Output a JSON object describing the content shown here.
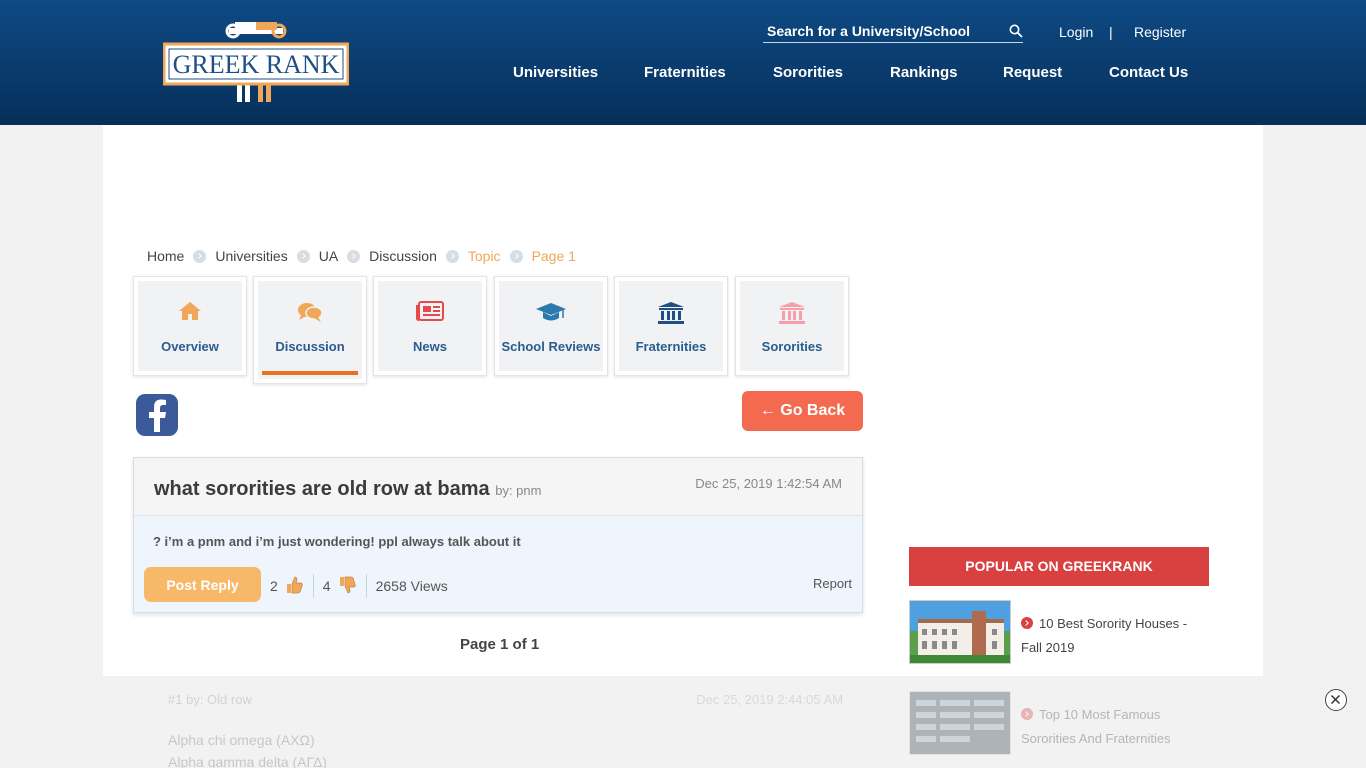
{
  "header": {
    "logo_text": "GREEK RANK",
    "search_placeholder": "Search for a University/School",
    "login": "Login",
    "divider": "|",
    "register": "Register",
    "nav": [
      "Universities",
      "Fraternities",
      "Sororities",
      "Rankings",
      "Request",
      "Contact Us"
    ]
  },
  "breadcrumb": [
    "Home",
    "Universities",
    "UA",
    "Discussion",
    "Topic",
    "Page 1"
  ],
  "tabs": [
    {
      "label": "Overview",
      "icon": "home-icon",
      "color": "#f0a75a"
    },
    {
      "label": "Discussion",
      "icon": "chat-icon",
      "color": "#f0a75a"
    },
    {
      "label": "News",
      "icon": "newspaper-icon",
      "color": "#e44a4a"
    },
    {
      "label": "School Reviews",
      "icon": "graduation-cap-icon",
      "color": "#2a7ab0"
    },
    {
      "label": "Fraternities",
      "icon": "column-building-icon",
      "color": "#1f4f85"
    },
    {
      "label": "Sororities",
      "icon": "column-building-icon",
      "color": "#f5a0a8"
    }
  ],
  "actions": {
    "go_back": "← Go Back"
  },
  "topic": {
    "title": "what sororities are old row at bama",
    "by": "by: pnm",
    "date": "Dec 25, 2019 1:42:54 AM",
    "message": "? i’m a pnm and i’m just wondering! ppl always talk about it",
    "post_reply": "Post Reply",
    "upvotes": "2",
    "downvotes": "4",
    "views": "2658 Views",
    "report": "Report"
  },
  "pagination": "Page 1 of 1",
  "reply_preview": {
    "index": "#1",
    "by": "by: Old row",
    "date": "Dec 25, 2019 2:44:05 AM",
    "lines": [
      "Alpha chi omega (ΑΧΩ)",
      "Alpha gamma delta (ΑΓΔ)"
    ]
  },
  "sidebar": {
    "heading": "POPULAR ON GREEKRANK",
    "items": [
      {
        "title": "10 Best Sorority Houses - Fall 2019"
      },
      {
        "title": "Top 10 Most Famous Sororities And Fraternities"
      }
    ]
  },
  "colors": {
    "header": "#0a3a6c",
    "accent_orange": "#e8701f",
    "go_back": "#f36a50",
    "popular": "#d94040"
  }
}
